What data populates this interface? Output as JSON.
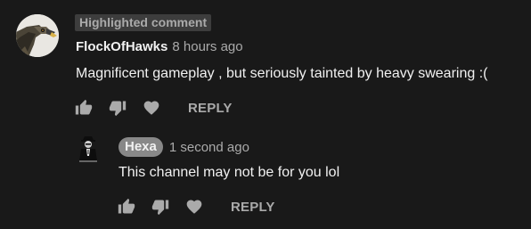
{
  "theme": {
    "background": "#191919",
    "text_primary": "#f1f1f1",
    "text_secondary": "#aaaaaa",
    "badge_bg": "#3d3d3d",
    "author_chip_bg": "#888888"
  },
  "comment": {
    "highlight_badge": "Highlighted comment",
    "author": "FlockOfHawks",
    "timestamp": "8 hours ago",
    "text": "Magnificent gameplay , but seriously tainted by heavy swearing :(",
    "avatar_icon": "hawk-avatar",
    "actions": {
      "like_icon": "thumbs-up-icon",
      "dislike_icon": "thumbs-down-icon",
      "heart_icon": "heart-icon",
      "reply_label": "REPLY"
    }
  },
  "reply": {
    "author": "Hexa",
    "timestamp": "1 second ago",
    "text": "This channel may not be for you lol",
    "avatar_icon": "suited-figure-avatar",
    "actions": {
      "like_icon": "thumbs-up-icon",
      "dislike_icon": "thumbs-down-icon",
      "heart_icon": "heart-icon",
      "reply_label": "REPLY"
    }
  }
}
